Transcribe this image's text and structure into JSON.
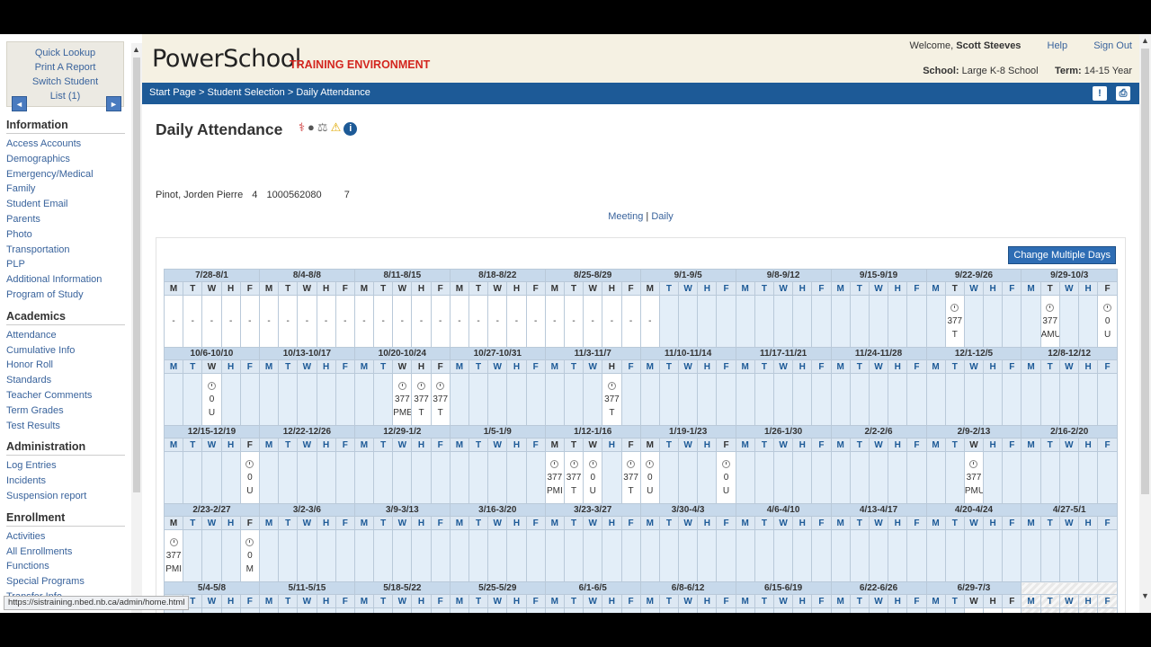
{
  "sidebar": {
    "quick": [
      "Quick Lookup",
      "Print A Report",
      "Switch Student",
      "List (1)"
    ],
    "prev_icon": "◄",
    "next_icon": "►",
    "sections": [
      {
        "title": "Information",
        "links": [
          "Access Accounts",
          "Demographics",
          "Emergency/Medical",
          "Family",
          "Student Email",
          "Parents",
          "Photo",
          "Transportation",
          "PLP",
          "Additional Information",
          "Program of Study"
        ]
      },
      {
        "title": "Academics",
        "links": [
          "Attendance",
          "Cumulative Info",
          "Honor Roll",
          "Standards",
          "Teacher Comments",
          "Term Grades",
          "Test Results"
        ]
      },
      {
        "title": "Administration",
        "links": [
          "Log Entries",
          "Incidents",
          "Suspension report"
        ]
      },
      {
        "title": "Enrollment",
        "links": [
          "Activities",
          "All Enrollments",
          "Functions",
          "Special Programs",
          "Transfer Info"
        ]
      }
    ]
  },
  "header": {
    "logo": "PowerSchool",
    "environment": "TRAINING ENVIRONMENT",
    "welcome_prefix": "Welcome,",
    "user": "Scott Steeves",
    "help": "Help",
    "signout": "Sign Out",
    "school_label": "School:",
    "school": "Large K-8 School",
    "term_label": "Term:",
    "term": "14-15 Year"
  },
  "breadcrumb": {
    "start": "Start Page",
    "sep1": " > ",
    "selection": "Student Selection",
    "sep2": " > ",
    "current": "Daily Attendance"
  },
  "page": {
    "title": "Daily Attendance",
    "student_name": "Pinot, Jorden Pierre",
    "grade": "4",
    "student_number": "1000562080",
    "home_room": "7",
    "view_meeting": "Meeting",
    "view_sep": "|",
    "view_daily": "Daily",
    "change_button": "Change Multiple Days"
  },
  "status_url": "https://sistraining.nbed.nb.ca/admin/home.html",
  "attendance": {
    "weeks": [
      [
        {
          "label": "7/28-8/1",
          "days": [
            "M",
            "T",
            "W",
            "H",
            "F"
          ],
          "cells": [
            "-",
            "-",
            "-",
            "-",
            "-"
          ]
        },
        {
          "label": "8/4-8/8",
          "days": [
            "M",
            "T",
            "W",
            "H",
            "F"
          ],
          "cells": [
            "-",
            "-",
            "-",
            "-",
            "-"
          ]
        },
        {
          "label": "8/11-8/15",
          "days": [
            "M",
            "T",
            "W",
            "H",
            "F"
          ],
          "cells": [
            "-",
            "-",
            "-",
            "-",
            "-"
          ]
        },
        {
          "label": "8/18-8/22",
          "days": [
            "M",
            "T",
            "W",
            "H",
            "F"
          ],
          "cells": [
            "-",
            "-",
            "-",
            "-",
            "-"
          ]
        },
        {
          "label": "8/25-8/29",
          "days": [
            "M",
            "T",
            "W",
            "H",
            "F"
          ],
          "cells": [
            "-",
            "-",
            "-",
            "-",
            "-"
          ]
        },
        {
          "label": "9/1-9/5",
          "days": [
            "M",
            "T",
            "W",
            "H",
            "F"
          ],
          "cells": [
            "-",
            "",
            "",
            "",
            ""
          ]
        },
        {
          "label": "9/8-9/12",
          "days": [
            "M",
            "T",
            "W",
            "H",
            "F"
          ],
          "cells": [
            "",
            "",
            "",
            "",
            ""
          ]
        },
        {
          "label": "9/15-9/19",
          "days": [
            "M",
            "T",
            "W",
            "H",
            "F"
          ],
          "cells": [
            "",
            "",
            "",
            "",
            ""
          ]
        },
        {
          "label": "9/22-9/26",
          "days": [
            "M",
            "T",
            "W",
            "H",
            "F"
          ],
          "cells": [
            "",
            "clock|377|T",
            "",
            "",
            ""
          ]
        },
        {
          "label": "9/29-10/3",
          "days": [
            "M",
            "T",
            "W",
            "H",
            "F"
          ],
          "cells": [
            "",
            "clock|377|AMU",
            "",
            "",
            "clock|0|U"
          ]
        }
      ],
      [
        {
          "label": "10/6-10/10",
          "days": [
            "M",
            "T",
            "W",
            "H",
            "F"
          ],
          "cells": [
            "",
            "",
            "clock|0|U",
            "",
            ""
          ]
        },
        {
          "label": "10/13-10/17",
          "days": [
            "M",
            "T",
            "W",
            "H",
            "F"
          ],
          "cells": [
            "",
            "",
            "",
            "",
            ""
          ]
        },
        {
          "label": "10/20-10/24",
          "days": [
            "M",
            "T",
            "W",
            "H",
            "F"
          ],
          "cells": [
            "",
            "",
            "clock|377|PME",
            "clock|377|T",
            "clock|377|T"
          ]
        },
        {
          "label": "10/27-10/31",
          "days": [
            "M",
            "T",
            "W",
            "H",
            "F"
          ],
          "cells": [
            "",
            "",
            "",
            "",
            ""
          ]
        },
        {
          "label": "11/3-11/7",
          "days": [
            "M",
            "T",
            "W",
            "H",
            "F"
          ],
          "cells": [
            "",
            "",
            "",
            "clock|377|T",
            ""
          ]
        },
        {
          "label": "11/10-11/14",
          "days": [
            "M",
            "T",
            "W",
            "H",
            "F"
          ],
          "cells": [
            "",
            "",
            "",
            "",
            ""
          ]
        },
        {
          "label": "11/17-11/21",
          "days": [
            "M",
            "T",
            "W",
            "H",
            "F"
          ],
          "cells": [
            "",
            "",
            "",
            "",
            ""
          ]
        },
        {
          "label": "11/24-11/28",
          "days": [
            "M",
            "T",
            "W",
            "H",
            "F"
          ],
          "cells": [
            "",
            "",
            "",
            "",
            ""
          ]
        },
        {
          "label": "12/1-12/5",
          "days": [
            "M",
            "T",
            "W",
            "H",
            "F"
          ],
          "cells": [
            "",
            "",
            "",
            "",
            ""
          ]
        },
        {
          "label": "12/8-12/12",
          "days": [
            "M",
            "T",
            "W",
            "H",
            "F"
          ],
          "cells": [
            "",
            "",
            "",
            "",
            ""
          ]
        }
      ],
      [
        {
          "label": "12/15-12/19",
          "days": [
            "M",
            "T",
            "W",
            "H",
            "F"
          ],
          "cells": [
            "",
            "",
            "",
            "",
            "clock|0|U"
          ]
        },
        {
          "label": "12/22-12/26",
          "days": [
            "M",
            "T",
            "W",
            "H",
            "F"
          ],
          "cells": [
            "",
            "",
            "",
            "",
            ""
          ]
        },
        {
          "label": "12/29-1/2",
          "days": [
            "M",
            "T",
            "W",
            "H",
            "F"
          ],
          "cells": [
            "",
            "",
            "",
            "",
            ""
          ]
        },
        {
          "label": "1/5-1/9",
          "days": [
            "M",
            "T",
            "W",
            "H",
            "F"
          ],
          "cells": [
            "",
            "",
            "",
            "",
            ""
          ]
        },
        {
          "label": "1/12-1/16",
          "days": [
            "M",
            "T",
            "W",
            "H",
            "F"
          ],
          "cells": [
            "clock|377|PMI",
            "clock|377|T",
            "clock|0|U",
            "",
            "clock|377|T"
          ]
        },
        {
          "label": "1/19-1/23",
          "days": [
            "M",
            "T",
            "W",
            "H",
            "F"
          ],
          "cells": [
            "clock|0|U",
            "",
            "",
            "",
            "clock|0|U"
          ]
        },
        {
          "label": "1/26-1/30",
          "days": [
            "M",
            "T",
            "W",
            "H",
            "F"
          ],
          "cells": [
            "",
            "",
            "",
            "",
            ""
          ]
        },
        {
          "label": "2/2-2/6",
          "days": [
            "M",
            "T",
            "W",
            "H",
            "F"
          ],
          "cells": [
            "",
            "",
            "",
            "",
            ""
          ]
        },
        {
          "label": "2/9-2/13",
          "days": [
            "M",
            "T",
            "W",
            "H",
            "F"
          ],
          "cells": [
            "",
            "",
            "clock|377|PMU",
            "",
            ""
          ]
        },
        {
          "label": "2/16-2/20",
          "days": [
            "M",
            "T",
            "W",
            "H",
            "F"
          ],
          "cells": [
            "",
            "",
            "",
            "",
            ""
          ]
        }
      ],
      [
        {
          "label": "2/23-2/27",
          "days": [
            "M",
            "T",
            "W",
            "H",
            "F"
          ],
          "cells": [
            "clock|377|PMI",
            "",
            "",
            "",
            "clock|0|M"
          ]
        },
        {
          "label": "3/2-3/6",
          "days": [
            "M",
            "T",
            "W",
            "H",
            "F"
          ],
          "cells": [
            "",
            "",
            "",
            "",
            ""
          ]
        },
        {
          "label": "3/9-3/13",
          "days": [
            "M",
            "T",
            "W",
            "H",
            "F"
          ],
          "cells": [
            "",
            "",
            "",
            "",
            ""
          ]
        },
        {
          "label": "3/16-3/20",
          "days": [
            "M",
            "T",
            "W",
            "H",
            "F"
          ],
          "cells": [
            "",
            "",
            "",
            "",
            ""
          ]
        },
        {
          "label": "3/23-3/27",
          "days": [
            "M",
            "T",
            "W",
            "H",
            "F"
          ],
          "cells": [
            "",
            "",
            "",
            "",
            ""
          ]
        },
        {
          "label": "3/30-4/3",
          "days": [
            "M",
            "T",
            "W",
            "H",
            "F"
          ],
          "cells": [
            "",
            "",
            "",
            "",
            ""
          ]
        },
        {
          "label": "4/6-4/10",
          "days": [
            "M",
            "T",
            "W",
            "H",
            "F"
          ],
          "cells": [
            "",
            "",
            "",
            "",
            ""
          ]
        },
        {
          "label": "4/13-4/17",
          "days": [
            "M",
            "T",
            "W",
            "H",
            "F"
          ],
          "cells": [
            "",
            "",
            "",
            "",
            ""
          ]
        },
        {
          "label": "4/20-4/24",
          "days": [
            "M",
            "T",
            "W",
            "H",
            "F"
          ],
          "cells": [
            "",
            "",
            "",
            "",
            ""
          ]
        },
        {
          "label": "4/27-5/1",
          "days": [
            "M",
            "T",
            "W",
            "H",
            "F"
          ],
          "cells": [
            "",
            "",
            "",
            "",
            ""
          ]
        }
      ],
      [
        {
          "label": "5/4-5/8",
          "days": [
            "M",
            "T",
            "W",
            "H",
            "F"
          ],
          "cells": [
            "",
            "",
            "",
            "",
            ""
          ]
        },
        {
          "label": "5/11-5/15",
          "days": [
            "M",
            "T",
            "W",
            "H",
            "F"
          ],
          "cells": [
            "",
            "",
            "",
            "",
            ""
          ]
        },
        {
          "label": "5/18-5/22",
          "days": [
            "M",
            "T",
            "W",
            "H",
            "F"
          ],
          "cells": [
            "",
            "",
            "",
            "",
            ""
          ]
        },
        {
          "label": "5/25-5/29",
          "days": [
            "M",
            "T",
            "W",
            "H",
            "F"
          ],
          "cells": [
            "",
            "",
            "",
            "",
            ""
          ]
        },
        {
          "label": "6/1-6/5",
          "days": [
            "M",
            "T",
            "W",
            "H",
            "F"
          ],
          "cells": [
            "",
            "",
            "",
            "",
            ""
          ]
        },
        {
          "label": "6/8-6/12",
          "days": [
            "M",
            "T",
            "W",
            "H",
            "F"
          ],
          "cells": [
            "",
            "",
            "",
            "",
            ""
          ]
        },
        {
          "label": "6/15-6/19",
          "days": [
            "M",
            "T",
            "W",
            "H",
            "F"
          ],
          "cells": [
            "",
            "",
            "",
            "",
            ""
          ]
        },
        {
          "label": "6/22-6/26",
          "days": [
            "M",
            "T",
            "W",
            "H",
            "F"
          ],
          "cells": [
            "",
            "",
            "",
            "",
            ""
          ]
        },
        {
          "label": "6/29-7/3",
          "days": [
            "M",
            "T",
            "W",
            "H",
            "F"
          ],
          "cells": [
            "",
            "",
            "-",
            "-",
            "-"
          ]
        },
        {
          "label": "",
          "days": [
            "M",
            "T",
            "W",
            "H",
            "F"
          ],
          "cells": [
            "",
            "",
            "",
            "",
            ""
          ],
          "hatch": true
        }
      ]
    ]
  }
}
